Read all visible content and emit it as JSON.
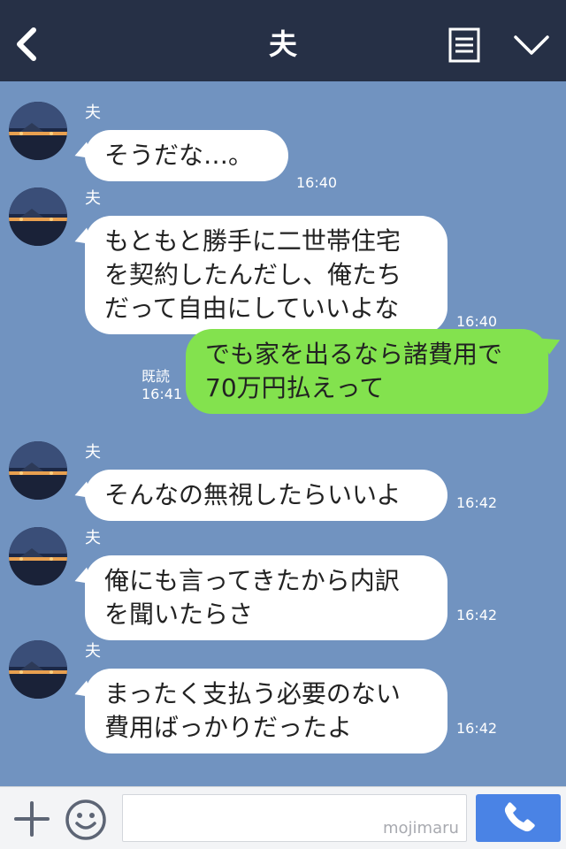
{
  "header": {
    "title": "夫",
    "back_icon": "chevron-left-icon",
    "menu_icon": "document-list-icon",
    "collapse_icon": "chevron-down-icon"
  },
  "messages": [
    {
      "type": "in",
      "sender": "夫",
      "lines": [
        "そうだな…。"
      ],
      "time": "16:40"
    },
    {
      "type": "in",
      "sender": "夫",
      "lines": [
        "もともと勝手に二世帯住宅",
        "を契約したんだし、俺たち",
        "だって自由にしていいよな"
      ],
      "time": "16:40"
    },
    {
      "type": "out",
      "read": "既読",
      "lines": [
        "でも家を出るなら諸費用で",
        "70万円払えって"
      ],
      "time": "16:41"
    },
    {
      "type": "in",
      "sender": "夫",
      "lines": [
        "そんなの無視したらいいよ"
      ],
      "time": "16:42"
    },
    {
      "type": "in",
      "sender": "夫",
      "lines": [
        "俺にも言ってきたから内訳",
        "を聞いたらさ"
      ],
      "time": "16:42"
    },
    {
      "type": "in",
      "sender": "夫",
      "lines": [
        "まったく支払う必要のない",
        "費用ばっかりだったよ"
      ],
      "time": "16:42"
    }
  ],
  "footer": {
    "plus_icon": "plus-icon",
    "emoji_icon": "smiley-icon",
    "input_value": "",
    "watermark": "mojimaru",
    "call_icon": "phone-icon"
  },
  "colors": {
    "header_bg": "#263046",
    "chat_bg": "#7193c0",
    "incoming_bubble": "#ffffff",
    "outgoing_bubble": "#83e24e",
    "call_button": "#4a83e5"
  }
}
